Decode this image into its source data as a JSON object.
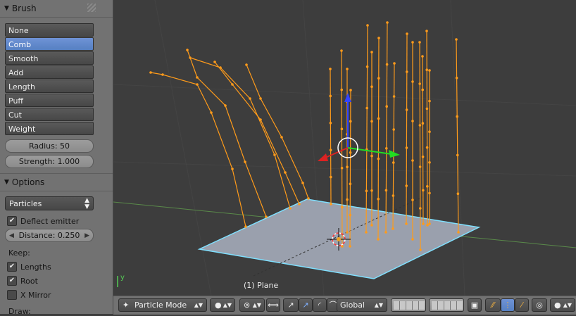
{
  "brush_panel": {
    "title": "Brush",
    "items": [
      "None",
      "Comb",
      "Smooth",
      "Add",
      "Length",
      "Puff",
      "Cut",
      "Weight"
    ],
    "selected": "Comb",
    "radius_label": "Radius: 50",
    "strength_label": "Strength: 1.000"
  },
  "options_panel": {
    "title": "Options",
    "mode_select": "Particles",
    "deflect_emitter": {
      "label": "Deflect emitter",
      "checked": true
    },
    "distance_label": "Distance: 0.250",
    "keep_label": "Keep:",
    "lengths": {
      "label": "Lengths",
      "checked": true
    },
    "root": {
      "label": "Root",
      "checked": true
    },
    "x_mirror": {
      "label": "X Mirror",
      "checked": false
    },
    "draw_label": "Draw:"
  },
  "viewport": {
    "object_label": "(1) Plane",
    "axis_y_label": "y"
  },
  "toolbar": {
    "mode_select": "Particle Mode",
    "orientation_select": "Global"
  },
  "colors": {
    "accent": "#5680c2",
    "hair": "#ff9b1a",
    "plane": "#9aa0ad",
    "plane_edge": "#7fe0ff"
  }
}
